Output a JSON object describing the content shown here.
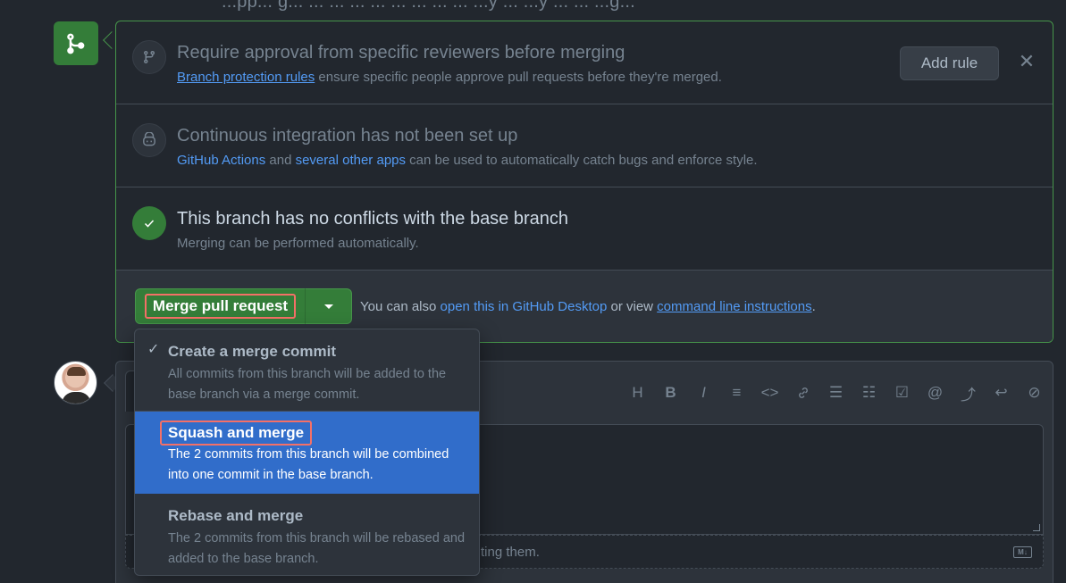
{
  "top_cut_text": "...pp... g... ... ... ... ... ... ... ... ... ...y ... ...y ... ... ...g...",
  "merge_box": {
    "reviewers": {
      "title": "Require approval from specific reviewers before merging",
      "link": "Branch protection rules",
      "text": "ensure specific people approve pull requests before they're merged.",
      "add_rule_label": "Add rule",
      "close_glyph": "✕"
    },
    "ci": {
      "title": "Continuous integration has not been set up",
      "link1": "GitHub Actions",
      "and_text": "and",
      "link2": "several other apps",
      "text": "can be used to automatically catch bugs and enforce style."
    },
    "conflicts": {
      "title": "This branch has no conflicts with the base branch",
      "text": "Merging can be performed automatically."
    },
    "merge_action": {
      "button_label": "Merge pull request",
      "also_prefix": "You can also",
      "desktop_link": "open this in GitHub Desktop",
      "or_view": "or view",
      "cli_link": "command line instructions",
      "period": "."
    }
  },
  "dropdown": {
    "items": [
      {
        "title": "Create a merge commit",
        "description": "All commits from this branch will be added to the base branch via a merge commit.",
        "selected": true,
        "check_glyph": "✓"
      },
      {
        "title": "Squash and merge",
        "description": "The 2 commits from this branch will be combined into one commit in the base branch.",
        "highlighted": true
      },
      {
        "title": "Rebase and merge",
        "description": "The 2 commits from this branch will be rebased and added to the base branch."
      }
    ]
  },
  "comment": {
    "toolbar": [
      "H",
      "B",
      "I",
      "≡",
      "<>",
      "🔗",
      "☰",
      "☷",
      "☑",
      "@",
      "⤴",
      "↩",
      "⊘"
    ],
    "attach_text": "ting them.",
    "md_badge": "M↓"
  },
  "colors": {
    "background": "#22272e",
    "success_green": "#347d39",
    "accent_blue": "#539bf5",
    "highlight_blue": "#316dca",
    "annotation_red": "#f47067"
  }
}
